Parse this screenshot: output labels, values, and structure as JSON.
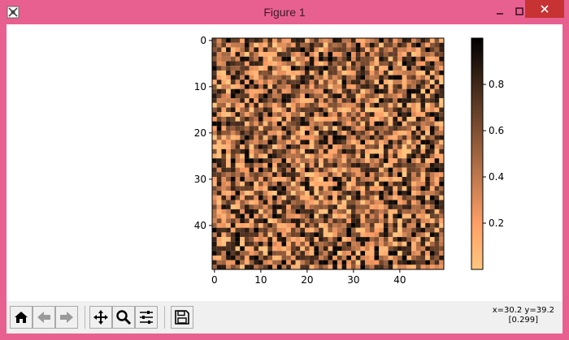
{
  "window": {
    "title": "Figure 1",
    "app_icon": "matplotlib-icon",
    "controls": {
      "minimize": "minimize-icon",
      "maximize": "maximize-icon",
      "close": "close-icon"
    }
  },
  "toolbar": {
    "buttons": [
      {
        "name": "home",
        "icon": "home-icon"
      },
      {
        "name": "back",
        "icon": "arrow-left-icon"
      },
      {
        "name": "forward",
        "icon": "arrow-right-icon"
      },
      {
        "name": "pan",
        "icon": "move-icon"
      },
      {
        "name": "zoom",
        "icon": "magnifier-icon"
      },
      {
        "name": "subplots",
        "icon": "sliders-icon"
      },
      {
        "name": "save",
        "icon": "floppy-icon"
      }
    ],
    "coords_line1": "x=30.2 y=39.2",
    "coords_line2": "[0.299]"
  },
  "colors": {
    "titlebar": "#e8608f",
    "close_button": "#c73333",
    "toolbar": "#f0f0f0"
  },
  "chart_data": {
    "type": "heatmap",
    "colormap": "copper_r",
    "rows": 50,
    "cols": 50,
    "values": "uniform random values in [0, 1)",
    "xticks": [
      0,
      10,
      20,
      30,
      40
    ],
    "yticks": [
      0,
      10,
      20,
      30,
      40
    ],
    "colorbar": {
      "range": [
        0,
        1
      ],
      "ticks": [
        0.2,
        0.4,
        0.6,
        0.8
      ],
      "tick_labels": [
        "0.2",
        "0.4",
        "0.6",
        "0.8"
      ]
    },
    "grid": false
  }
}
